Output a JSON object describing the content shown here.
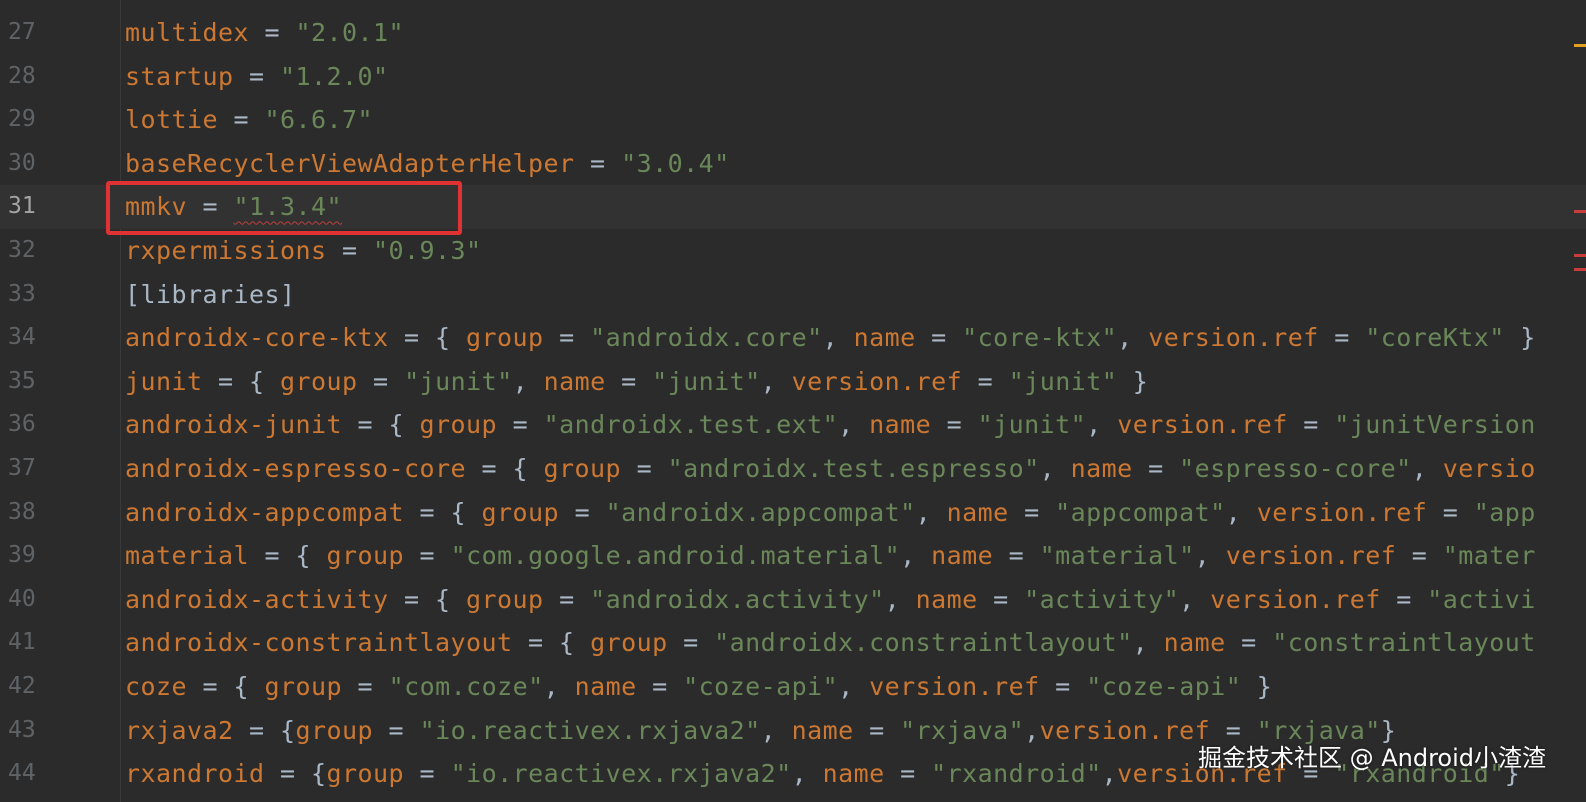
{
  "editor": {
    "current_line": "31",
    "lines": [
      {
        "num": "27",
        "parts": [
          [
            "k",
            "multidex"
          ],
          [
            "p",
            " = "
          ],
          [
            "s",
            "\"2.0.1\""
          ]
        ]
      },
      {
        "num": "28",
        "parts": [
          [
            "k",
            "startup"
          ],
          [
            "p",
            " = "
          ],
          [
            "s",
            "\"1.2.0\""
          ]
        ]
      },
      {
        "num": "29",
        "parts": [
          [
            "k",
            "lottie"
          ],
          [
            "p",
            " = "
          ],
          [
            "s",
            "\"6.6.7\""
          ]
        ]
      },
      {
        "num": "30",
        "parts": [
          [
            "k",
            "baseRecyclerViewAdapterHelper"
          ],
          [
            "p",
            " = "
          ],
          [
            "s",
            "\"3.0.4\""
          ]
        ]
      },
      {
        "num": "31",
        "parts": [
          [
            "k",
            "mmkv"
          ],
          [
            "p",
            " = "
          ],
          [
            "s err",
            "\"1.3.4\""
          ]
        ]
      },
      {
        "num": "32",
        "parts": [
          [
            "k",
            "rxpermissions"
          ],
          [
            "p",
            " = "
          ],
          [
            "s",
            "\"0.9.3\""
          ]
        ]
      },
      {
        "num": "33",
        "parts": [
          [
            "p",
            "[libraries]"
          ]
        ]
      },
      {
        "num": "34",
        "parts": [
          [
            "k",
            "androidx-core-ktx"
          ],
          [
            "p",
            " = { "
          ],
          [
            "k",
            "group"
          ],
          [
            "p",
            " = "
          ],
          [
            "s",
            "\"androidx.core\""
          ],
          [
            "p",
            ", "
          ],
          [
            "k",
            "name"
          ],
          [
            "p",
            " = "
          ],
          [
            "s",
            "\"core-ktx\""
          ],
          [
            "p",
            ", "
          ],
          [
            "k",
            "version.ref"
          ],
          [
            "p",
            " = "
          ],
          [
            "s",
            "\"coreKtx\""
          ],
          [
            "p",
            " }"
          ]
        ]
      },
      {
        "num": "35",
        "parts": [
          [
            "k",
            "junit"
          ],
          [
            "p",
            " = { "
          ],
          [
            "k",
            "group"
          ],
          [
            "p",
            " = "
          ],
          [
            "s",
            "\"junit\""
          ],
          [
            "p",
            ", "
          ],
          [
            "k",
            "name"
          ],
          [
            "p",
            " = "
          ],
          [
            "s",
            "\"junit\""
          ],
          [
            "p",
            ", "
          ],
          [
            "k",
            "version.ref"
          ],
          [
            "p",
            " = "
          ],
          [
            "s",
            "\"junit\""
          ],
          [
            "p",
            " }"
          ]
        ]
      },
      {
        "num": "36",
        "parts": [
          [
            "k",
            "androidx-junit"
          ],
          [
            "p",
            " = { "
          ],
          [
            "k",
            "group"
          ],
          [
            "p",
            " = "
          ],
          [
            "s",
            "\"androidx.test.ext\""
          ],
          [
            "p",
            ", "
          ],
          [
            "k",
            "name"
          ],
          [
            "p",
            " = "
          ],
          [
            "s",
            "\"junit\""
          ],
          [
            "p",
            ", "
          ],
          [
            "k",
            "version.ref"
          ],
          [
            "p",
            " = "
          ],
          [
            "s",
            "\"junitVersion"
          ]
        ]
      },
      {
        "num": "37",
        "parts": [
          [
            "k",
            "androidx-espresso-core"
          ],
          [
            "p",
            " = { "
          ],
          [
            "k",
            "group"
          ],
          [
            "p",
            " = "
          ],
          [
            "s",
            "\"androidx.test.espresso\""
          ],
          [
            "p",
            ", "
          ],
          [
            "k",
            "name"
          ],
          [
            "p",
            " = "
          ],
          [
            "s",
            "\"espresso-core\""
          ],
          [
            "p",
            ", "
          ],
          [
            "k",
            "versio"
          ]
        ]
      },
      {
        "num": "38",
        "parts": [
          [
            "k",
            "androidx-appcompat"
          ],
          [
            "p",
            " = { "
          ],
          [
            "k",
            "group"
          ],
          [
            "p",
            " = "
          ],
          [
            "s",
            "\"androidx.appcompat\""
          ],
          [
            "p",
            ", "
          ],
          [
            "k",
            "name"
          ],
          [
            "p",
            " = "
          ],
          [
            "s",
            "\"appcompat\""
          ],
          [
            "p",
            ", "
          ],
          [
            "k",
            "version.ref"
          ],
          [
            "p",
            " = "
          ],
          [
            "s",
            "\"app"
          ]
        ]
      },
      {
        "num": "39",
        "parts": [
          [
            "k",
            "material"
          ],
          [
            "p",
            " = { "
          ],
          [
            "k",
            "group"
          ],
          [
            "p",
            " = "
          ],
          [
            "s",
            "\"com.google.android.material\""
          ],
          [
            "p",
            ", "
          ],
          [
            "k",
            "name"
          ],
          [
            "p",
            " = "
          ],
          [
            "s",
            "\"material\""
          ],
          [
            "p",
            ", "
          ],
          [
            "k",
            "version.ref"
          ],
          [
            "p",
            " = "
          ],
          [
            "s",
            "\"mater"
          ]
        ]
      },
      {
        "num": "40",
        "parts": [
          [
            "k",
            "androidx-activity"
          ],
          [
            "p",
            " = { "
          ],
          [
            "k",
            "group"
          ],
          [
            "p",
            " = "
          ],
          [
            "s",
            "\"androidx.activity\""
          ],
          [
            "p",
            ", "
          ],
          [
            "k",
            "name"
          ],
          [
            "p",
            " = "
          ],
          [
            "s",
            "\"activity\""
          ],
          [
            "p",
            ", "
          ],
          [
            "k",
            "version.ref"
          ],
          [
            "p",
            " = "
          ],
          [
            "s",
            "\"activi"
          ]
        ]
      },
      {
        "num": "41",
        "parts": [
          [
            "k",
            "androidx-constraintlayout"
          ],
          [
            "p",
            " = { "
          ],
          [
            "k",
            "group"
          ],
          [
            "p",
            " = "
          ],
          [
            "s",
            "\"androidx.constraintlayout\""
          ],
          [
            "p",
            ", "
          ],
          [
            "k",
            "name"
          ],
          [
            "p",
            " = "
          ],
          [
            "s",
            "\"constraintlayout"
          ]
        ]
      },
      {
        "num": "42",
        "parts": [
          [
            "k",
            "coze"
          ],
          [
            "p",
            " = { "
          ],
          [
            "k",
            "group"
          ],
          [
            "p",
            " = "
          ],
          [
            "s",
            "\"com.coze\""
          ],
          [
            "p",
            ", "
          ],
          [
            "k",
            "name"
          ],
          [
            "p",
            " = "
          ],
          [
            "s",
            "\"coze-api\""
          ],
          [
            "p",
            ", "
          ],
          [
            "k",
            "version.ref"
          ],
          [
            "p",
            " = "
          ],
          [
            "s",
            "\"coze-api\""
          ],
          [
            "p",
            " }"
          ]
        ]
      },
      {
        "num": "43",
        "parts": [
          [
            "k",
            "rxjava2"
          ],
          [
            "p",
            " = {"
          ],
          [
            "k",
            "group"
          ],
          [
            "p",
            " = "
          ],
          [
            "s",
            "\"io.reactivex.rxjava2\""
          ],
          [
            "p",
            ", "
          ],
          [
            "k",
            "name"
          ],
          [
            "p",
            " = "
          ],
          [
            "s",
            "\"rxjava\""
          ],
          [
            "p",
            ","
          ],
          [
            "k",
            "version.ref"
          ],
          [
            "p",
            " = "
          ],
          [
            "s",
            "\"rxjava\""
          ],
          [
            "p",
            "}"
          ]
        ]
      },
      {
        "num": "44",
        "parts": [
          [
            "k",
            "rxandroid"
          ],
          [
            "p",
            " = {"
          ],
          [
            "k",
            "group"
          ],
          [
            "p",
            " = "
          ],
          [
            "s",
            "\"io.reactivex.rxjava2\""
          ],
          [
            "p",
            ", "
          ],
          [
            "k",
            "name"
          ],
          [
            "p",
            " = "
          ],
          [
            "s",
            "\"rxandroid\""
          ],
          [
            "p",
            ","
          ],
          [
            "k",
            "version.ref"
          ],
          [
            "p",
            " = "
          ],
          [
            "s",
            "\"rxandroid\""
          ],
          [
            "p",
            "}"
          ]
        ]
      }
    ]
  },
  "colors": {
    "background": "#2b2b2b",
    "keyword": "#cc7832",
    "string": "#6a8759",
    "punctuation": "#a9b7c6",
    "highlight_box": "#e03232"
  },
  "watermark": "掘金技术社区 @ Android小渣渣"
}
